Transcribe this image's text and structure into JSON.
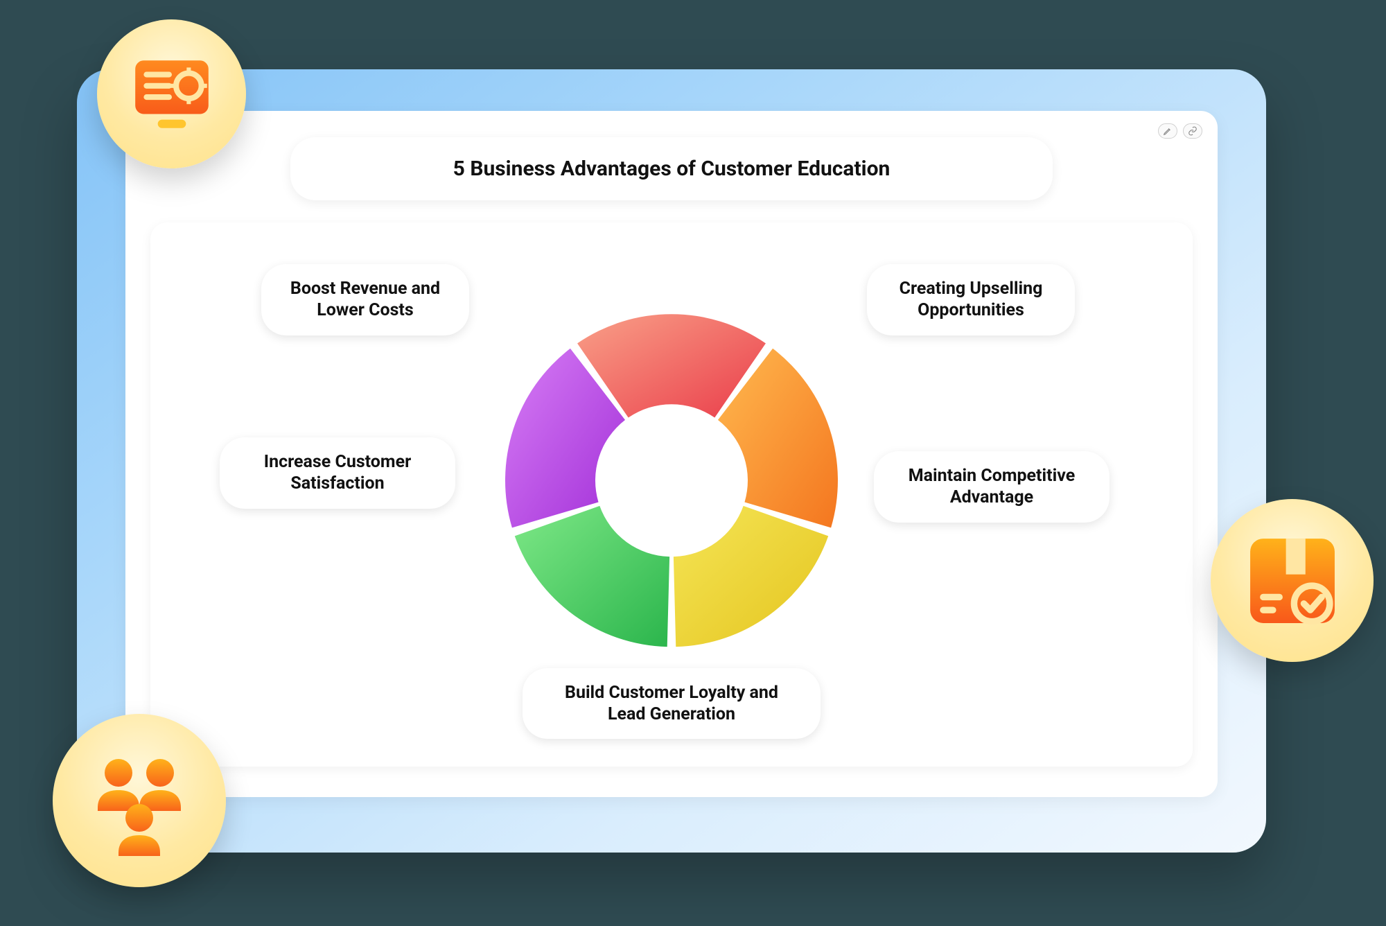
{
  "title": "5 Business Advantages  of Customer Education",
  "labels": {
    "tl": "Boost Revenue and Lower Costs",
    "tr": "Creating Upselling Opportunities",
    "r": "Maintain Competitive Advantage",
    "b": "Build Customer Loyalty and Lead Generation",
    "l": "Increase Customer Satisfaction"
  },
  "badges": {
    "tl": "computer-settings-icon",
    "bl": "people-group-icon",
    "r": "package-check-icon"
  },
  "chart_data": {
    "type": "pie",
    "title": "5 Business Advantages of Customer Education",
    "categories": [
      "Boost Revenue and Lower Costs",
      "Creating Upselling Opportunities",
      "Maintain Competitive Advantage",
      "Build Customer Loyalty and Lead Generation",
      "Increase Customer Satisfaction"
    ],
    "values": [
      1,
      1,
      1,
      1,
      1
    ],
    "colors": [
      "#f05c5c",
      "#f8932b",
      "#eed93a",
      "#4bcf63",
      "#b94ee6"
    ],
    "donut": true
  }
}
